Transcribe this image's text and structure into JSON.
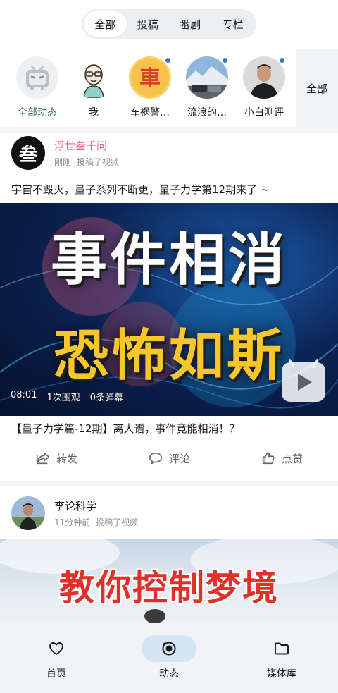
{
  "top_tabs": [
    {
      "label": "全部"
    },
    {
      "label": "投稿"
    },
    {
      "label": "番剧"
    },
    {
      "label": "专栏"
    }
  ],
  "following": {
    "items": [
      {
        "label": "全部动态"
      },
      {
        "label": "我"
      },
      {
        "label": "车祸警…"
      },
      {
        "label": "流浪的…"
      },
      {
        "label": "小白测评"
      }
    ],
    "all_label": "全部"
  },
  "post1": {
    "author": "浮世叁千问",
    "avatar_char": "叁",
    "time": "刚刚",
    "action": "投稿了视频",
    "text": "宇宙不毁灭，量子系列不断更，量子力学第12期来了 ~",
    "cover_line1": "事件相消",
    "cover_line2": "恐怖如斯",
    "duration": "08:01",
    "views": "1次围观",
    "danmaku": "0条弹幕",
    "title": "【量子力学篇-12期】离大谱，事件竟能相消！？",
    "actions": {
      "share": "转发",
      "comment": "评论",
      "like": "点赞"
    }
  },
  "post2": {
    "author": "李论科学",
    "time": "11分钟前",
    "action": "投稿了视频",
    "cover_title": "教你控制梦境"
  },
  "bottom_nav": [
    {
      "label": "首页",
      "icon": "heart-icon"
    },
    {
      "label": "动态",
      "icon": "dynamic-icon"
    },
    {
      "label": "媒体库",
      "icon": "folder-icon"
    }
  ],
  "colors": {
    "accent_pink": "#e86a9a",
    "nav_active": "#d6e4f3",
    "dot_blue": "#3f78a8"
  }
}
